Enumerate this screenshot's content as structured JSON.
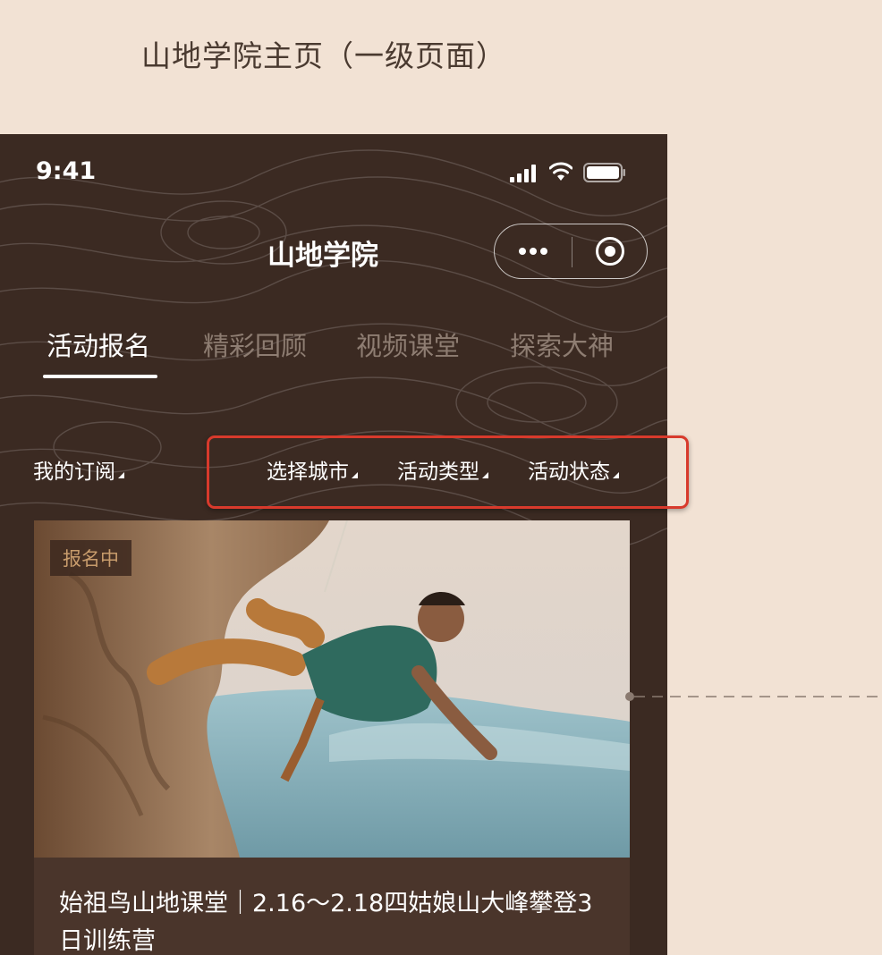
{
  "annotation": {
    "caption": "山地学院主页（一级页面）"
  },
  "status_bar": {
    "time": "9:41",
    "icons": [
      "signal-icon",
      "wifi-icon",
      "battery-icon"
    ]
  },
  "nav": {
    "title": "山地学院",
    "capsule": {
      "more_icon": "more-dots-icon",
      "close_icon": "target-ring-icon"
    }
  },
  "tabs": [
    {
      "label": "活动报名",
      "active": true
    },
    {
      "label": "精彩回顾",
      "active": false
    },
    {
      "label": "视频课堂",
      "active": false
    },
    {
      "label": "探索大神",
      "active": false
    }
  ],
  "filters": {
    "subscription": "我的订阅",
    "city": "选择城市",
    "type": "活动类型",
    "status": "活动状态"
  },
  "card": {
    "badge": "报名中",
    "title": "始祖鸟山地课堂｜2.16～2.18四姑娘山大峰攀登3日训练营"
  },
  "colors": {
    "page_background": "#f2e2d4",
    "app_background": "#3b2a22",
    "card_background": "#4a352b",
    "badge_text": "#c89c6c",
    "highlight_box": "#d83a2c",
    "tab_inactive": "#8e7d72"
  }
}
